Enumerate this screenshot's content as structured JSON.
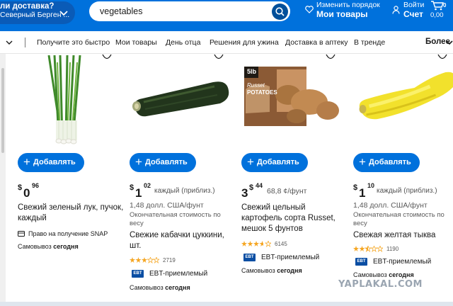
{
  "header": {
    "pickup_line1": "ли доставка?",
    "pickup_line2": "Северный Берген ...",
    "search_value": "vegetables",
    "reorder_small": "Изменить порядок",
    "reorder_big": "Мои товары",
    "account_small": "Войти",
    "account_big": "Счет",
    "cart_count": "0",
    "cart_sum": "0,00"
  },
  "nav": {
    "items": [
      "Получите это быстро",
      "Мои товары",
      "День отца",
      "Решения для ужина",
      "Доставка в аптеку",
      "В тренде"
    ],
    "more": "Более"
  },
  "products": [
    {
      "add_label": "Добавлять",
      "price_currency": "$",
      "price_whole": "0",
      "price_cents": "96",
      "title_line1": "Свежий зеленый лук, пучок,",
      "title_line2": "каждый",
      "snap": "Право на получение SNAP",
      "pickup_label": "Самовывоз",
      "pickup_when": "сегодня"
    },
    {
      "add_label": "Добавлять",
      "price_currency": "$",
      "price_whole": "1",
      "price_cents": "02",
      "price_unit": "каждый (приблиз.)",
      "per_unit": "1,48 долл. США/фунт",
      "final_line1": "Окончательная стоимость по",
      "final_line2": "весу",
      "title_line1": "Свежие кабачки цуккини,",
      "title_line2": "шт.",
      "rating_stars": 3,
      "review_count": "2719",
      "ebt": "EBT-приемлемый",
      "pickup_label": "Самовывоз",
      "pickup_when": "сегодня"
    },
    {
      "add_label": "Добавлять",
      "price_currency": "$",
      "price_whole": "3",
      "price_cents": "44",
      "price_unit": "68,8 ¢/фунт",
      "title_line1": "Свежий цельный",
      "title_line2": "картофель сорта Russet,",
      "title_line3": "мешок 5 фунтов",
      "rating_stars": 3.5,
      "review_count": "6145",
      "ebt": "EBT-приемлемый",
      "pickup_label": "Самовывоз",
      "pickup_when": "сегодня",
      "bag_brand_top": "5lb",
      "bag_brand_mid": "Russet",
      "bag_brand_bottom": "POTATOES"
    },
    {
      "add_label": "Добавлять",
      "price_currency": "$",
      "price_whole": "1",
      "price_cents": "10",
      "price_unit": "каждый (приблиз.)",
      "per_unit": "1,48 долл. США/фунт",
      "final_line1": "Окончательная стоимость по",
      "final_line2": "весу",
      "title_line1": "Свежая желтая тыква",
      "rating_stars": 2.5,
      "review_count": "1190",
      "ebt": "EBT-приемлемый",
      "pickup_label": "Самовывоз",
      "pickup_when": "сегодня"
    }
  ],
  "watermark": "YAPLAKAL.COM",
  "colors": {
    "brand_blue": "#0071dc",
    "dark_blue": "#004f9a",
    "star": "#f5a623",
    "ebt": "#0a4ea3"
  }
}
